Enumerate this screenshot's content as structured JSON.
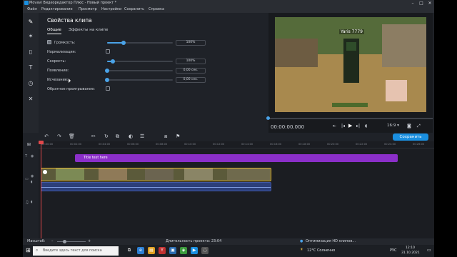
{
  "window": {
    "title": "Movavi Видеоредактор Плюс - Новый проект *"
  },
  "menu": [
    "Файл",
    "Редактирование",
    "Просмотр",
    "Настройки",
    "Сохранить",
    "Справка"
  ],
  "panel": {
    "title": "Свойства клипа",
    "tabs": [
      "Общие",
      "Эффекты на клипе"
    ],
    "props": [
      {
        "label": "Громкость:",
        "value": "100%",
        "pct": 0.25
      },
      {
        "label": "Нормализация:"
      },
      {
        "label": "Скорость:",
        "value": "100%",
        "pct": 0.09
      },
      {
        "label": "Появление:",
        "value": "0,00 сек.",
        "pct": 0
      },
      {
        "label": "Исчезание:",
        "value": "0,00 сек.",
        "pct": 0
      },
      {
        "label": "Обратное проигрывание:"
      }
    ]
  },
  "preview": {
    "player_name": "Yaris 7779",
    "time": "00:00:00.000",
    "aspect": "16:9 ▾",
    "save": "Сохранить",
    "progress": 0
  },
  "timeline": {
    "ticks": [
      "00:00:00",
      "00:02:00",
      "00:04:00",
      "00:06:00",
      "00:08:00",
      "00:10:00",
      "00:12:00",
      "00:14:00",
      "00:16:00",
      "00:18:00",
      "00:20:00",
      "00:22:00",
      "00:24:00",
      "00:26:00"
    ],
    "title_clip": "Title text here"
  },
  "status": {
    "scale_label": "Масштаб:",
    "duration": "Длительность проекта: 23:04",
    "optimization": "Оптимизация HD клипов..."
  },
  "taskbar": {
    "search_placeholder": "Введите здесь текст для поиска",
    "weather": "12°C  Солнечно",
    "lang": "РУС",
    "time": "12:10",
    "date": "31.10.2021"
  },
  "colors": {
    "accent": "#1a8fe0",
    "title_clip": "#8b2fc9",
    "clip_border": "#e8b830",
    "playhead": "#e0484b"
  }
}
